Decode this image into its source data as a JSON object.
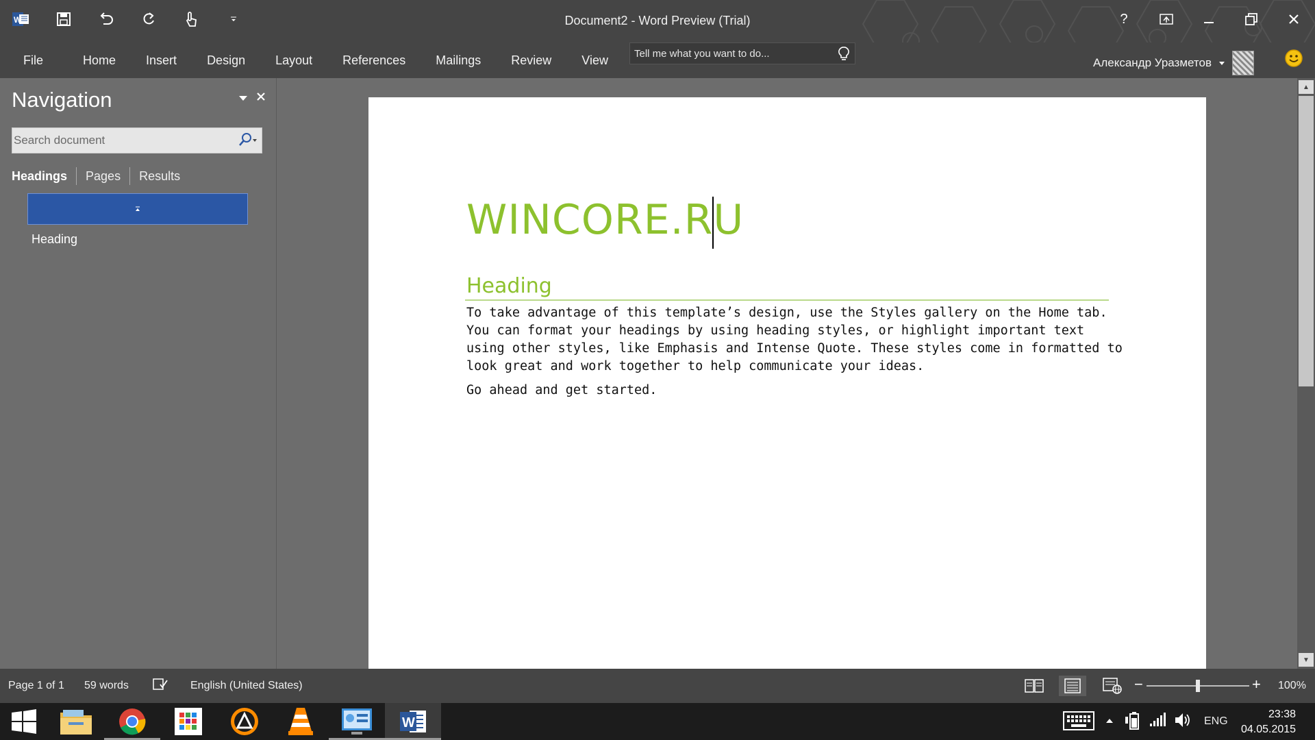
{
  "window": {
    "title": "Document2 - Word Preview (Trial)",
    "help_label": "?"
  },
  "ribbon": {
    "tabs": [
      "File",
      "Home",
      "Insert",
      "Design",
      "Layout",
      "References",
      "Mailings",
      "Review",
      "View"
    ],
    "tell_me_placeholder": "Tell me what you want to do...",
    "user_name": "Александр Уразметов"
  },
  "navigation": {
    "title": "Navigation",
    "search_placeholder": "Search document",
    "tabs": [
      "Headings",
      "Pages",
      "Results"
    ],
    "active_tab": "Headings",
    "headings": [
      "Heading"
    ]
  },
  "document": {
    "title_text": "WINCORE.RU",
    "heading_text": "Heading",
    "body_paragraph": "To take advantage of this template’s design, use the Styles gallery on the Home tab. You can format your headings by using heading styles, or highlight important text using other styles, like Emphasis and Intense Quote. These styles come in formatted to look great and work together to help communicate your ideas.",
    "body_paragraph_2": "Go ahead and get started.",
    "accent_color": "#8dc12e"
  },
  "statusbar": {
    "page": "Page 1 of 1",
    "words": "59 words",
    "language": "English (United States)",
    "zoom_level": "100%",
    "zoom_percent": 100
  },
  "taskbar": {
    "apps": [
      "start-icon",
      "file-explorer-icon",
      "chrome-icon",
      "store-apps-icon",
      "aimp-icon",
      "vlc-icon",
      "control-panel-icon",
      "word-icon"
    ],
    "tray": {
      "language": "ENG",
      "time": "23:38",
      "date": "04.05.2015"
    }
  }
}
